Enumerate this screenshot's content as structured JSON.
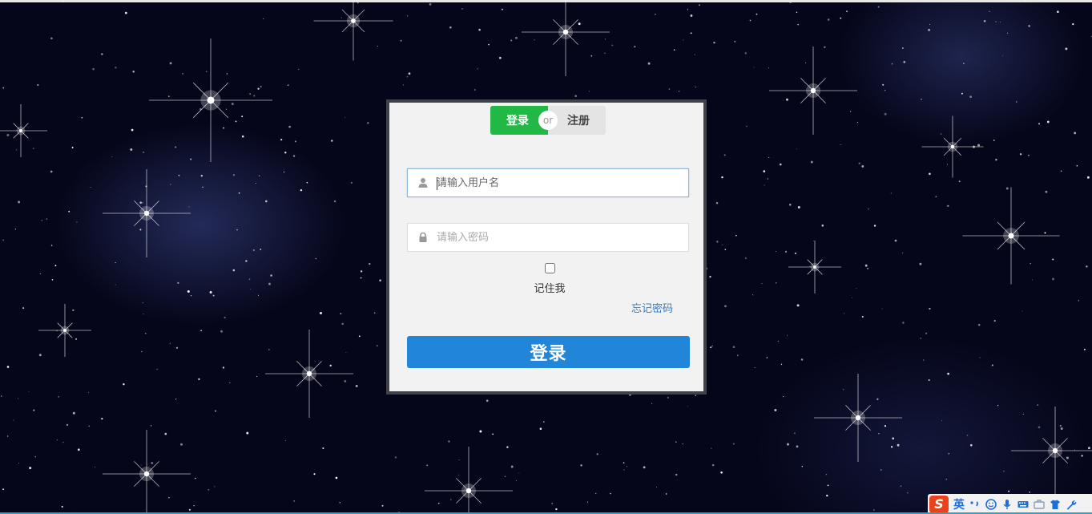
{
  "colors": {
    "background": "#05061a",
    "nebula": "#3c488c",
    "toggle_active": "#22b845",
    "toggle_inactive": "#e4e4e4",
    "panel": "#f2f2f2",
    "panel_border": "#3f4349",
    "submit": "#2185d8",
    "link": "#3a7bbf"
  },
  "mode_toggle": {
    "login_label": "登录",
    "or_label": "or",
    "register_label": "注册",
    "active": "login"
  },
  "username": {
    "placeholder": "请输入用户名",
    "value": "",
    "icon": "user-icon"
  },
  "password": {
    "placeholder": "请输入密码",
    "value": "",
    "icon": "lock-icon"
  },
  "remember": {
    "label": "记住我",
    "checked": false
  },
  "forgot_label": "忘记密码",
  "submit_label": "登录",
  "ime": {
    "mode_label": "英",
    "icons": [
      "sogou-logo-icon",
      "punctuation-icon",
      "emoji-icon",
      "microphone-icon",
      "keyboard-icon",
      "toolbox-icon",
      "skin-icon",
      "settings-wrench-icon"
    ]
  }
}
